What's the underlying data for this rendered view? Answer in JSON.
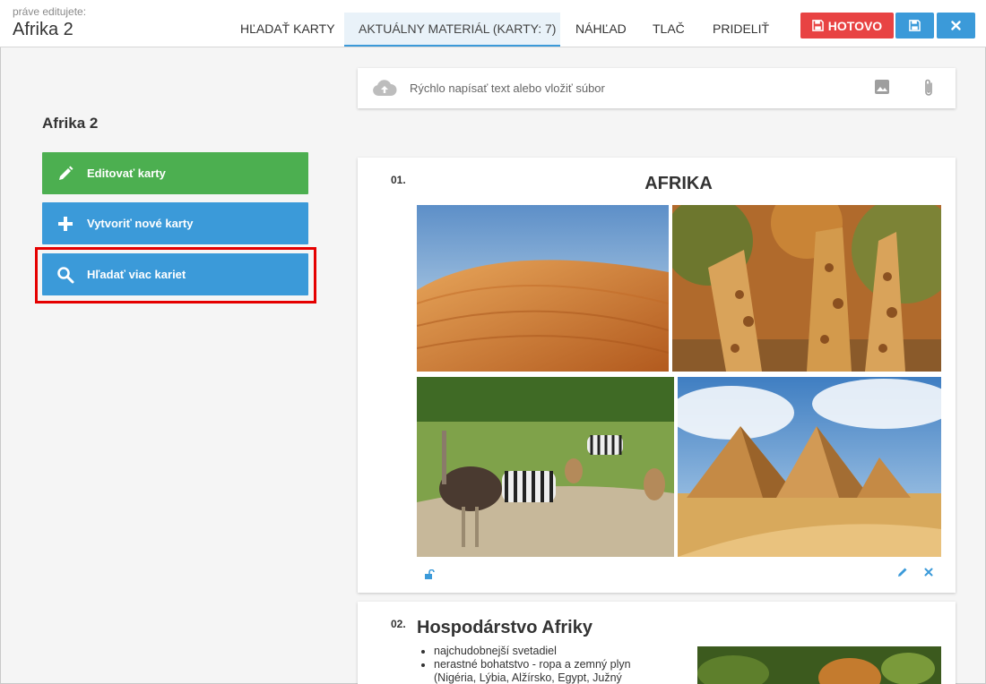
{
  "header": {
    "editing_label": "práve editujete:",
    "doc_title": "Afrika 2",
    "tabs": [
      {
        "label": "HĽADAŤ KARTY"
      },
      {
        "label": "AKTUÁLNY MATERIÁL (KARTY: 7)"
      },
      {
        "label": "NÁHĽAD"
      },
      {
        "label": "TLAČ"
      },
      {
        "label": "PRIDELIŤ"
      }
    ],
    "done_label": "HOTOVO"
  },
  "sidebar": {
    "title": "Afrika 2",
    "buttons": [
      {
        "label": "Editovať karty",
        "icon": "pencil-icon"
      },
      {
        "label": "Vytvoriť nové karty",
        "icon": "plus-icon"
      },
      {
        "label": "Hľadať viac kariet",
        "icon": "search-icon"
      }
    ]
  },
  "quick_input": {
    "placeholder": "Rýchlo napísať text alebo vložiť súbor"
  },
  "cards": [
    {
      "number": "01.",
      "title": "AFRIKA",
      "images": [
        "desert-dune",
        "giraffes",
        "ostrich-zebras",
        "pyramids"
      ]
    },
    {
      "number": "02.",
      "title": "Hospodárstvo Afriky",
      "bullets": [
        "najchudobnejší svetadiel",
        "nerastné bohatstvo - ropa a zemný plyn",
        "(Nigéria, Lýbia, Alžírsko, Egypt, Južný"
      ]
    }
  ],
  "colors": {
    "accent_blue": "#3b9ad9",
    "green": "#4caf50",
    "red": "#e84343",
    "highlight_red": "#e50000"
  }
}
